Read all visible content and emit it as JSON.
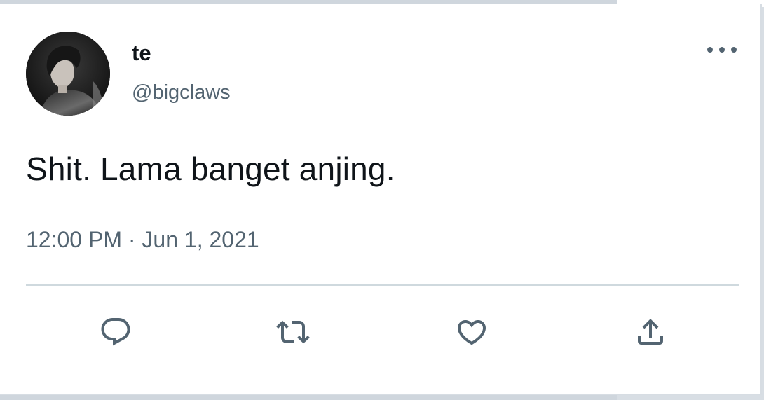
{
  "tweet": {
    "author": {
      "display_name": "te",
      "handle": "@bigclaws"
    },
    "text": "Shit. Lama banget anjing.",
    "timestamp": "12:00 PM · Jun 1, 2021",
    "actions": [
      "reply-icon",
      "retweet-icon",
      "like-icon",
      "share-icon"
    ],
    "more_icon": "more-icon"
  },
  "colors": {
    "text_primary": "#0f1419",
    "text_secondary": "#536471",
    "icon": "#536471",
    "divider": "#cfd9de",
    "background": "#ffffff"
  }
}
